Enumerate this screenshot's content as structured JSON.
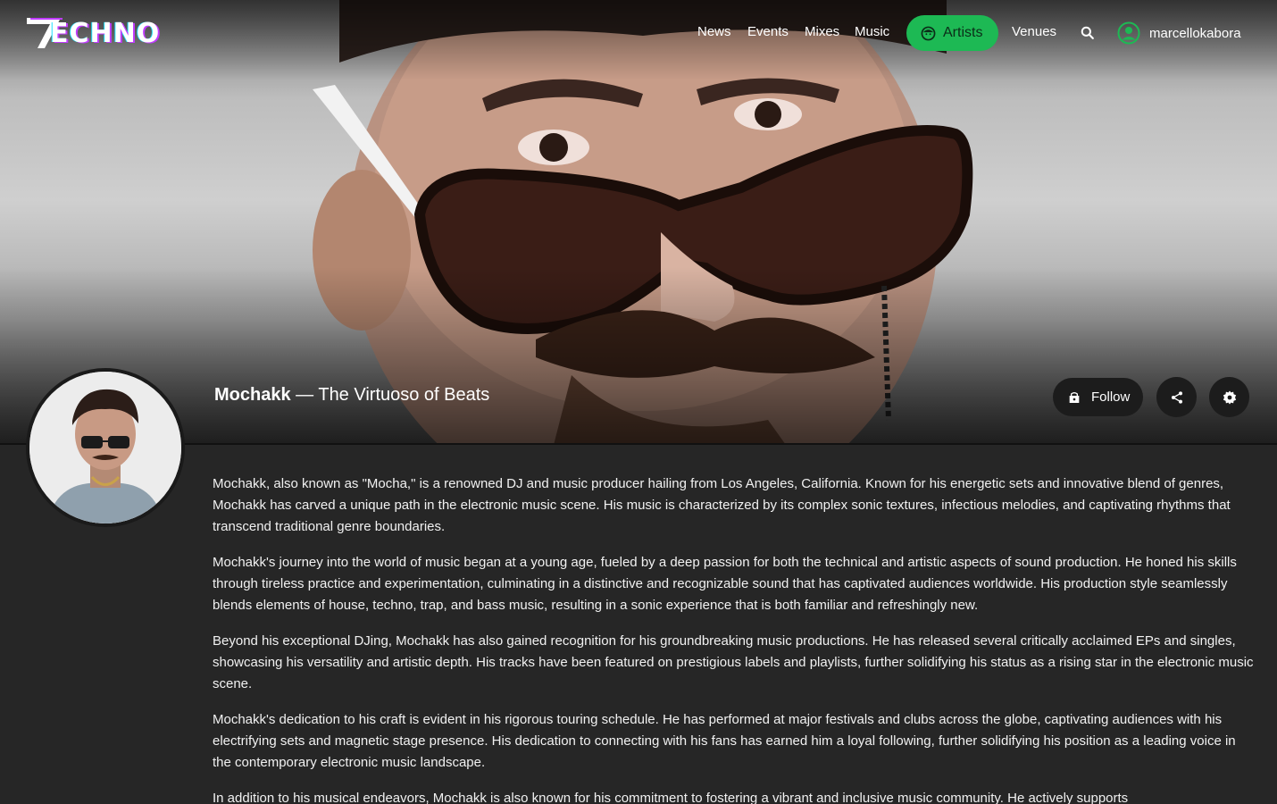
{
  "site": {
    "logo_text": "ECHNO"
  },
  "nav": {
    "links": [
      "News",
      "Events",
      "Mixes",
      "Music"
    ],
    "active": "Artists",
    "after": "Venues",
    "search_icon": "search-icon",
    "username": "marcellokabora"
  },
  "colors": {
    "accent": "#1db954",
    "background": "#262626",
    "button": "#1c1c1c"
  },
  "artist": {
    "name": "Mochakk",
    "tagline": " — The Virtuoso of Beats"
  },
  "actions": {
    "follow_label": "Follow",
    "share_icon": "share-icon",
    "settings_icon": "gear-icon"
  },
  "bio": [
    "Mochakk, also known as \"Mocha,\" is a renowned DJ and music producer hailing from Los Angeles, California. Known for his energetic sets and innovative blend of genres, Mochakk has carved a unique path in the electronic music scene. His music is characterized by its complex sonic textures, infectious melodies, and captivating rhythms that transcend traditional genre boundaries.",
    "Mochakk's journey into the world of music began at a young age, fueled by a deep passion for both the technical and artistic aspects of sound production. He honed his skills through tireless practice and experimentation, culminating in a distinctive and recognizable sound that has captivated audiences worldwide. His production style seamlessly blends elements of house, techno, trap, and bass music, resulting in a sonic experience that is both familiar and refreshingly new.",
    "Beyond his exceptional DJing, Mochakk has also gained recognition for his groundbreaking music productions. He has released several critically acclaimed EPs and singles, showcasing his versatility and artistic depth. His tracks have been featured on prestigious labels and playlists, further solidifying his status as a rising star in the electronic music scene.",
    "Mochakk's dedication to his craft is evident in his rigorous touring schedule. He has performed at major festivals and clubs across the globe, captivating audiences with his electrifying sets and magnetic stage presence. His dedication to connecting with his fans has earned him a loyal following, further solidifying his position as a leading voice in the contemporary electronic music landscape.",
    "In addition to his musical endeavors, Mochakk is also known for his commitment to fostering a vibrant and inclusive music community. He actively supports"
  ]
}
